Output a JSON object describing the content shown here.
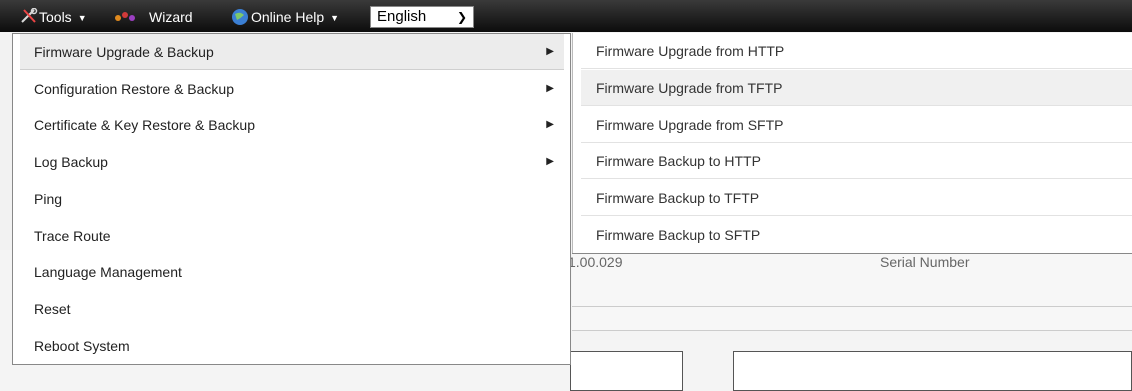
{
  "toolbar": {
    "tools_label": "Tools",
    "wizard_label": "Wizard",
    "help_label": "Online Help",
    "language_selected": "English",
    "tools_icon": "tools-icon",
    "wizard_icon": "wizard-icon",
    "help_icon": "help-globe-icon"
  },
  "tools_menu": {
    "items": [
      {
        "label": "Firmware Upgrade & Backup",
        "has_submenu": true
      },
      {
        "label": "Configuration Restore & Backup",
        "has_submenu": true
      },
      {
        "label": "Certificate & Key Restore & Backup",
        "has_submenu": true
      },
      {
        "label": "Log Backup",
        "has_submenu": true
      },
      {
        "label": "Ping",
        "has_submenu": false
      },
      {
        "label": "Trace Route",
        "has_submenu": false
      },
      {
        "label": "Language Management",
        "has_submenu": false
      },
      {
        "label": "Reset",
        "has_submenu": false
      },
      {
        "label": "Reboot System",
        "has_submenu": false
      }
    ]
  },
  "firmware_submenu": {
    "items": [
      {
        "label": "Firmware Upgrade from HTTP"
      },
      {
        "label": "Firmware Upgrade from TFTP"
      },
      {
        "label": "Firmware Upgrade from SFTP"
      },
      {
        "label": "Firmware Backup to HTTP"
      },
      {
        "label": "Firmware Backup to TFTP"
      },
      {
        "label": "Firmware Backup to SFTP"
      }
    ]
  },
  "background": {
    "firmware_version_fragment": "1.00.029",
    "serial_number_label": "Serial Number"
  }
}
